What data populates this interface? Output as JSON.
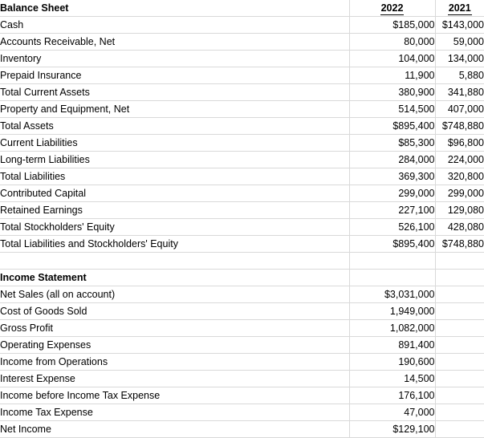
{
  "document": {
    "type": "spreadsheet",
    "colors": {
      "gridline": "#d9d9d9",
      "rule": "#000000",
      "background": "#ffffff"
    }
  },
  "columns": {
    "label_header": "",
    "year_1": "2022",
    "year_2": "2021"
  },
  "balance_sheet": {
    "title": "Balance Sheet",
    "rows": [
      {
        "label": "Cash",
        "y1": "$185,000",
        "y2": "$143,000",
        "indent": false,
        "rule_top": false,
        "rule_double": false
      },
      {
        "label": "Accounts Receivable, Net",
        "y1": "80,000",
        "y2": "59,000",
        "indent": false,
        "rule_top": false,
        "rule_double": false
      },
      {
        "label": "Inventory",
        "y1": "104,000",
        "y2": "134,000",
        "indent": false,
        "rule_top": false,
        "rule_double": false
      },
      {
        "label": "Prepaid Insurance",
        "y1": "11,900",
        "y2": "5,880",
        "indent": false,
        "rule_top": false,
        "rule_double": false
      },
      {
        "label": "Total Current Assets",
        "y1": "380,900",
        "y2": "341,880",
        "indent": true,
        "rule_top": true,
        "rule_double": false
      },
      {
        "label": "Property and Equipment, Net",
        "y1": "514,500",
        "y2": "407,000",
        "indent": false,
        "rule_top": false,
        "rule_double": false
      },
      {
        "label": "Total Assets",
        "y1": "$895,400",
        "y2": "$748,880",
        "indent": true,
        "rule_top": true,
        "rule_double": true
      },
      {
        "label": "Current Liabilities",
        "y1": "$85,300",
        "y2": "$96,800",
        "indent": false,
        "rule_top": false,
        "rule_double": false
      },
      {
        "label": "Long-term Liabilities",
        "y1": "284,000",
        "y2": "224,000",
        "indent": false,
        "rule_top": false,
        "rule_double": false
      },
      {
        "label": "Total Liabilities",
        "y1": "369,300",
        "y2": "320,800",
        "indent": true,
        "rule_top": true,
        "rule_double": false
      },
      {
        "label": "Contributed Capital",
        "y1": "299,000",
        "y2": "299,000",
        "indent": false,
        "rule_top": true,
        "rule_double": false
      },
      {
        "label": "Retained Earnings",
        "y1": "227,100",
        "y2": "129,080",
        "indent": false,
        "rule_top": false,
        "rule_double": false
      },
      {
        "label": "Total Stockholders' Equity",
        "y1": "526,100",
        "y2": "428,080",
        "indent": true,
        "rule_top": true,
        "rule_double": false
      },
      {
        "label": "Total Liabilities and Stockholders' Equity",
        "y1": "$895,400",
        "y2": "$748,880",
        "indent": true,
        "rule_top": false,
        "rule_double": true
      }
    ]
  },
  "spacer": {
    "label": "",
    "y1": "",
    "y2": ""
  },
  "income_statement": {
    "title": "Income Statement",
    "rows": [
      {
        "label": "Net Sales (all on account)",
        "y1": "$3,031,000",
        "y2": "",
        "indent": false,
        "rule_top": false,
        "rule_double": false
      },
      {
        "label": "Cost of Goods Sold",
        "y1": "1,949,000",
        "y2": "",
        "indent": false,
        "rule_top": false,
        "rule_double": false
      },
      {
        "label": "Gross Profit",
        "y1": "1,082,000",
        "y2": "",
        "indent": false,
        "rule_top": true,
        "rule_double": false
      },
      {
        "label": "Operating Expenses",
        "y1": "891,400",
        "y2": "",
        "indent": false,
        "rule_top": false,
        "rule_double": false
      },
      {
        "label": "Income from Operations",
        "y1": "190,600",
        "y2": "",
        "indent": false,
        "rule_top": true,
        "rule_double": false
      },
      {
        "label": "Interest Expense",
        "y1": "14,500",
        "y2": "",
        "indent": false,
        "rule_top": false,
        "rule_double": false
      },
      {
        "label": "Income before Income Tax Expense",
        "y1": "176,100",
        "y2": "",
        "indent": false,
        "rule_top": true,
        "rule_double": false
      },
      {
        "label": "Income Tax Expense",
        "y1": "47,000",
        "y2": "",
        "indent": false,
        "rule_top": false,
        "rule_double": false
      },
      {
        "label": "Net Income",
        "y1": "$129,100",
        "y2": "",
        "indent": false,
        "rule_top": true,
        "rule_double": false
      }
    ]
  }
}
